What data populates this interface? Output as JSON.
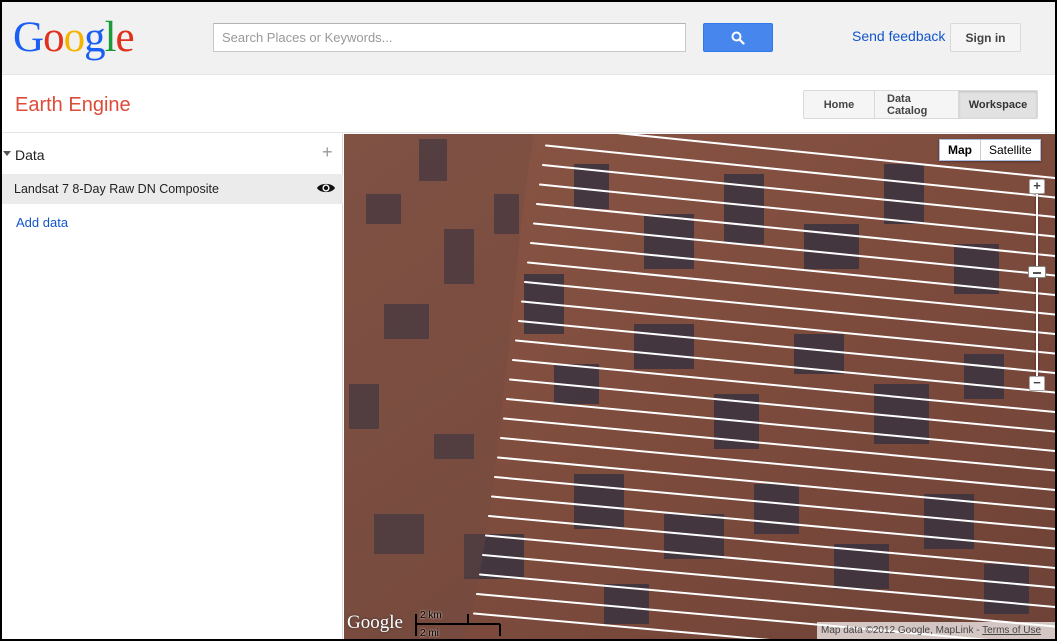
{
  "topbar": {
    "logo_text": "Google",
    "search_placeholder": "Search Places or Keywords...",
    "search_icon": "search-icon",
    "feedback_label": "Send feedback",
    "signin_label": "Sign in"
  },
  "header": {
    "app_title": "Earth Engine",
    "nav": [
      "Home",
      "Data Catalog",
      "Workspace"
    ],
    "active_nav": "Workspace"
  },
  "panel": {
    "title": "Data",
    "layers": [
      {
        "label": "Landsat 7 8-Day Raw DN Composite",
        "visible": true
      }
    ],
    "add_label": "Add data"
  },
  "map": {
    "types": [
      "Map",
      "Satellite"
    ],
    "active_type": "Map",
    "google_logo": "Google",
    "scale_km": "2 km",
    "scale_mi": "2 mi",
    "attribution": "Map data ©2012 Google, MapLink - ",
    "terms_label": "Terms of Use"
  },
  "colors": {
    "accent_red": "#dd4b39",
    "link_blue": "#1155cc",
    "search_button": "#4787ed",
    "terrain": "#7a4b3a"
  }
}
